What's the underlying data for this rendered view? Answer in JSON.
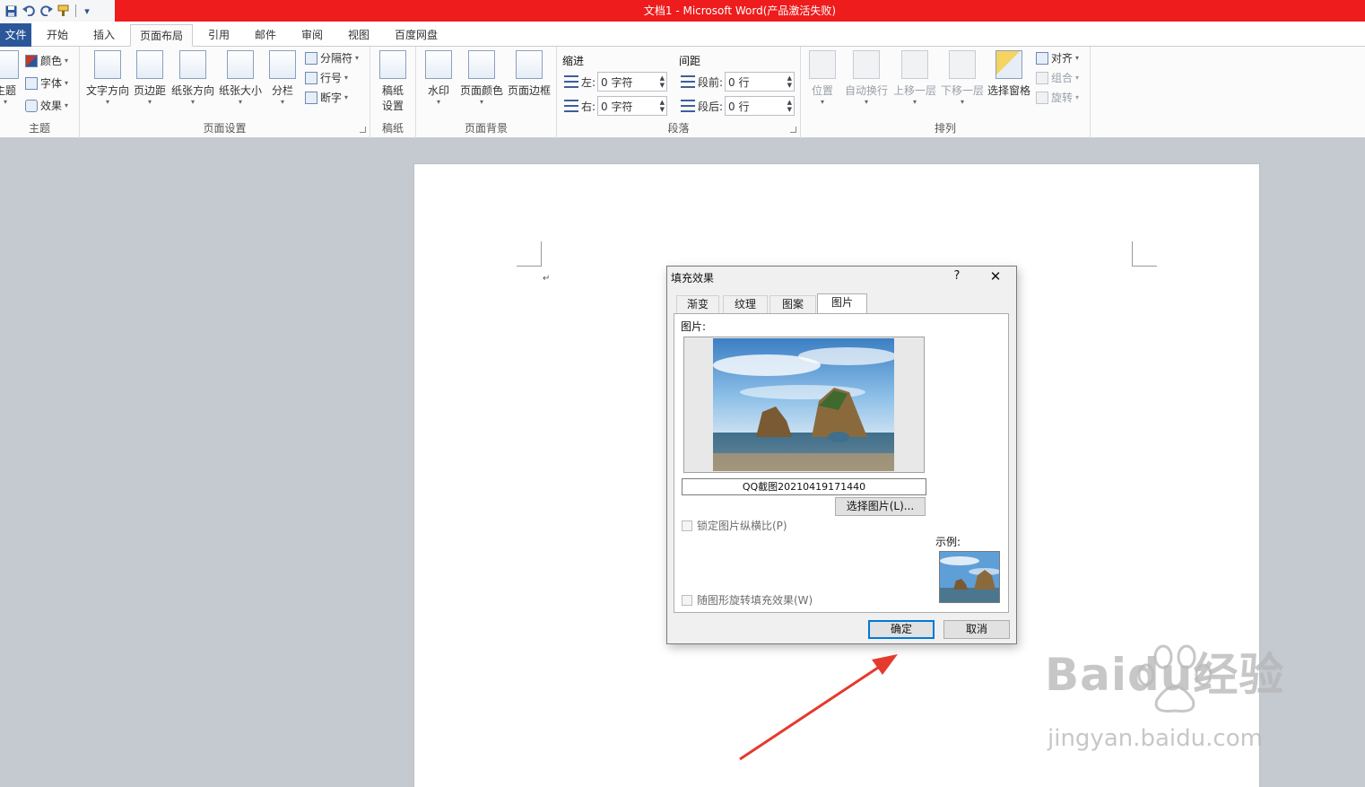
{
  "window": {
    "title": "文档1 - Microsoft Word(产品激活失败)"
  },
  "qat": {
    "icons": [
      "save-icon",
      "undo-icon",
      "redo-icon",
      "format-painter-icon",
      "customize-icon"
    ]
  },
  "tabs": [
    "文件",
    "开始",
    "插入",
    "页面布局",
    "引用",
    "邮件",
    "审阅",
    "视图",
    "百度网盘"
  ],
  "ribbon": {
    "themes": {
      "main": "主题",
      "colors": "颜色",
      "fonts": "字体",
      "effects": "效果",
      "group": "主题"
    },
    "page_setup": {
      "buttons": [
        "文字方向",
        "页边距",
        "纸张方向",
        "纸张大小",
        "分栏"
      ],
      "small": [
        "分隔符",
        "行号",
        "断字"
      ],
      "group": "页面设置"
    },
    "draft": {
      "button_line1": "稿纸",
      "button_line2": "设置",
      "group": "稿纸"
    },
    "background": {
      "buttons": [
        "水印",
        "页面颜色",
        "页面边框"
      ],
      "group": "页面背景"
    },
    "paragraph": {
      "indent_title": "缩进",
      "spacing_title": "间距",
      "left_label": "左:",
      "left_value": "0 字符",
      "right_label": "右:",
      "right_value": "0 字符",
      "before_label": "段前:",
      "before_value": "0 行",
      "after_label": "段后:",
      "after_value": "0 行",
      "group": "段落"
    },
    "arrange": {
      "buttons": [
        "位置",
        "自动换行",
        "上移一层",
        "下移一层",
        "选择窗格"
      ],
      "small": [
        "对齐",
        "组合",
        "旋转"
      ],
      "group": "排列"
    }
  },
  "document": {
    "para_mark": "↵"
  },
  "dialog": {
    "title": "填充效果",
    "help": "?",
    "close": "✕",
    "tabs": [
      "渐变",
      "纹理",
      "图案",
      "图片"
    ],
    "picture_label": "图片:",
    "file_name": "QQ截图20210419171440",
    "select_button": "选择图片(L)...",
    "lock_aspect": "锁定图片纵横比(P)",
    "rotate_fill": "随图形旋转填充效果(W)",
    "sample_label": "示例:",
    "ok": "确定",
    "cancel": "取消"
  },
  "watermark": {
    "logo": "Baidu经验",
    "url": "jingyan.baidu.com"
  }
}
